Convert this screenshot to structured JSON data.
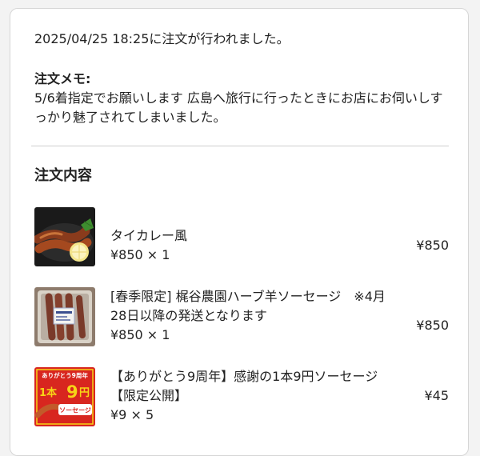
{
  "order": {
    "timestamp_text": "2025/04/25 18:25に注文が行われました。",
    "memo_heading": "注文メモ:",
    "memo_text": "5/6着指定でお願いします 広島へ旅行に行ったときにお店にお伺いしすっかり魅了されてしまいました。"
  },
  "items_section": {
    "title": "注文内容",
    "items": [
      {
        "name": "タイカレー風",
        "quantity": "¥850 × 1",
        "total": "¥850",
        "thumbnail": "sausage-curry-photo"
      },
      {
        "name": "[春季限定] 梶谷農園ハーブ羊ソーセージ　※4月28日以降の発送となります",
        "quantity": "¥850 × 1",
        "total": "¥850",
        "thumbnail": "packaged-sausage-photo"
      },
      {
        "name": "【ありがとう9周年】感謝の1本9円ソーセージ【限定公開】",
        "quantity": "¥9 × 5",
        "total": "¥45",
        "thumbnail": "anniversary-banner-image",
        "banner": {
          "line1": "ありがとう9周年",
          "line2a": "1本",
          "line2b": "9",
          "line2c": "円",
          "line3": "ソーセージ"
        }
      }
    ]
  },
  "colors": {
    "background": "#f3f3f3",
    "card": "#ffffff",
    "divider": "#cfcfcf",
    "banner_red": "#d8261f",
    "banner_yellow": "#f7d417"
  }
}
